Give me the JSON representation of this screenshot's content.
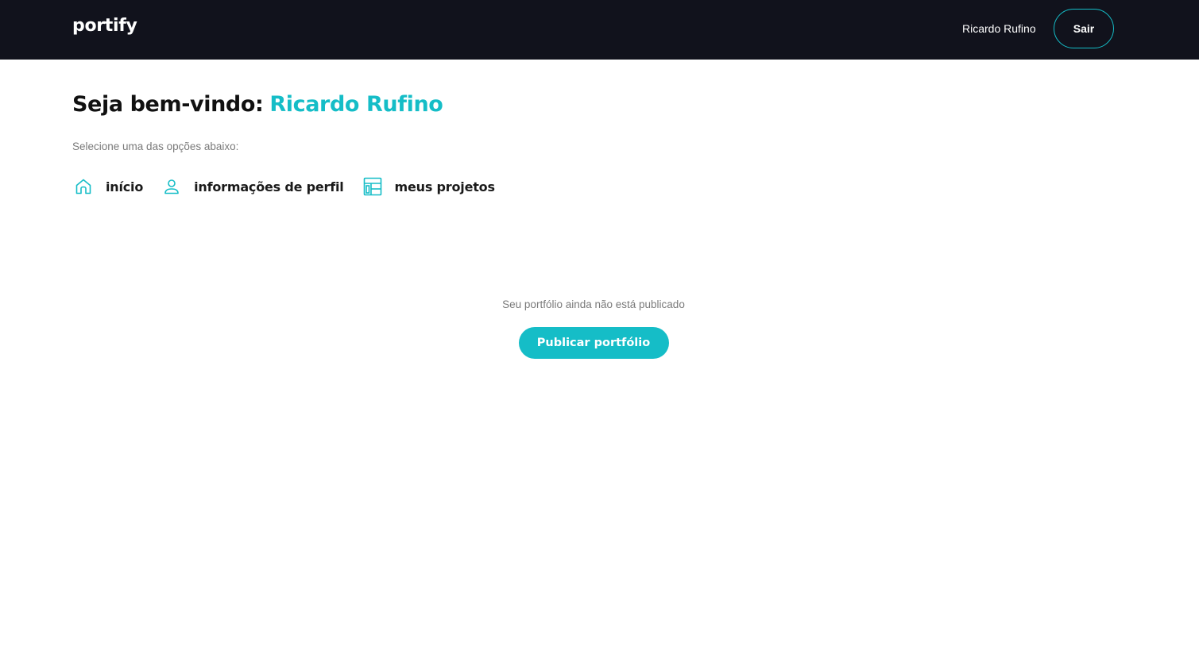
{
  "header": {
    "logo": "portify",
    "user_name": "Ricardo Rufino",
    "logout_label": "Sair"
  },
  "welcome": {
    "prefix": "Seja bem-vindo:",
    "name": "Ricardo Rufino"
  },
  "instruction": "Selecione uma das opções abaixo:",
  "nav": {
    "items": [
      {
        "label": "início",
        "icon": "home-icon"
      },
      {
        "label": "informações de perfil",
        "icon": "user-icon"
      },
      {
        "label": "meus projetos",
        "icon": "layout-icon"
      }
    ]
  },
  "empty_state": {
    "message": "Seu portfólio ainda não está publicado",
    "button_label": "Publicar portfólio"
  },
  "colors": {
    "accent": "#15bdc7",
    "header_bg": "#11121c"
  }
}
